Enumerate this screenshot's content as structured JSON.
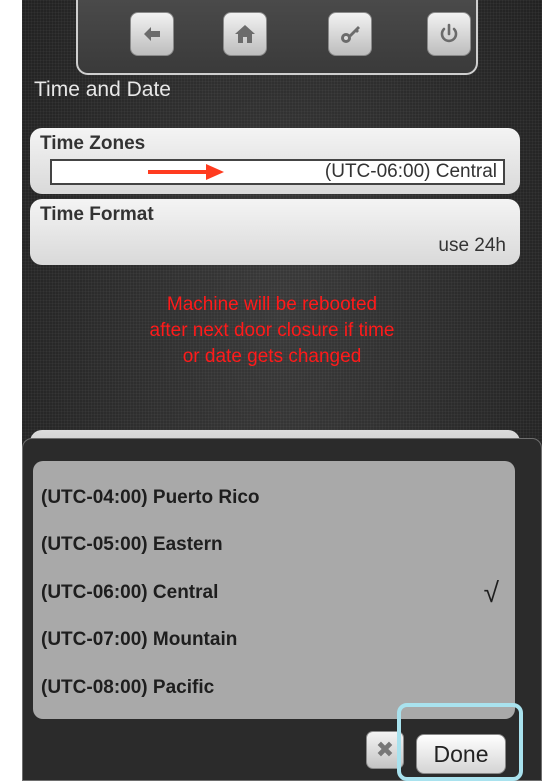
{
  "toolbar": {
    "buttons": [
      {
        "icon": "back-arrow-icon"
      },
      {
        "icon": "home-icon"
      },
      {
        "icon": "key-icon"
      },
      {
        "icon": "power-icon"
      }
    ]
  },
  "page": {
    "title": "Time and Date"
  },
  "time_zones": {
    "label": "Time Zones",
    "value": "(UTC-06:00) Central",
    "arrow_color": "#ff3b1f"
  },
  "time_format": {
    "label": "Time Format",
    "value": "use 24h"
  },
  "warning": {
    "lines": [
      "Machine will be rebooted",
      "after next door closure if time",
      "or date gets changed"
    ],
    "color": "#ff1a1a"
  },
  "picker": {
    "options": [
      {
        "label": "(UTC-04:00) Puerto Rico",
        "selected": false
      },
      {
        "label": "(UTC-05:00) Eastern",
        "selected": false
      },
      {
        "label": "(UTC-06:00) Central",
        "selected": true
      },
      {
        "label": "(UTC-07:00) Mountain",
        "selected": false
      },
      {
        "label": "(UTC-08:00) Pacific",
        "selected": false
      }
    ],
    "check_glyph": "√",
    "cancel_glyph": "✖",
    "done_label": "Done",
    "highlight_color": "#a9e2ee"
  }
}
